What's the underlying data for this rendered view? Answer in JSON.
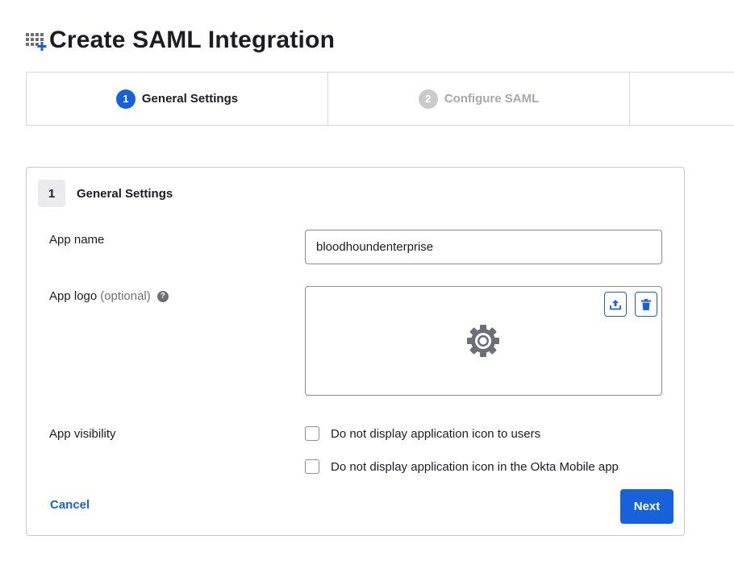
{
  "page": {
    "title": "Create SAML Integration",
    "icon": "app-grid-add-icon"
  },
  "stepper": {
    "steps": [
      {
        "number": "1",
        "label": "General Settings",
        "state": "active"
      },
      {
        "number": "2",
        "label": "Configure SAML",
        "state": "inactive"
      },
      {
        "number": "",
        "label": "",
        "state": "inactive"
      }
    ]
  },
  "panel": {
    "number": "1",
    "title": "General Settings",
    "app_name": {
      "label": "App name",
      "value": "bloodhoundenterprise"
    },
    "app_logo": {
      "label": "App logo",
      "optional": "(optional)",
      "help_icon": "question-circle-icon",
      "help_glyph": "?",
      "placeholder_icon": "gear-icon",
      "upload_icon": "upload-icon",
      "delete_icon": "trash-icon"
    },
    "app_visibility": {
      "label": "App visibility",
      "options": [
        {
          "label": "Do not display application icon to users",
          "checked": false
        },
        {
          "label": "Do not display application icon in the Okta Mobile app",
          "checked": false
        }
      ]
    },
    "cancel_label": "Cancel",
    "next_label": "Next"
  },
  "colors": {
    "accent": "#1662dd",
    "text": "#1d1d21",
    "muted": "#6e6e78",
    "border": "#d7d7dc"
  }
}
